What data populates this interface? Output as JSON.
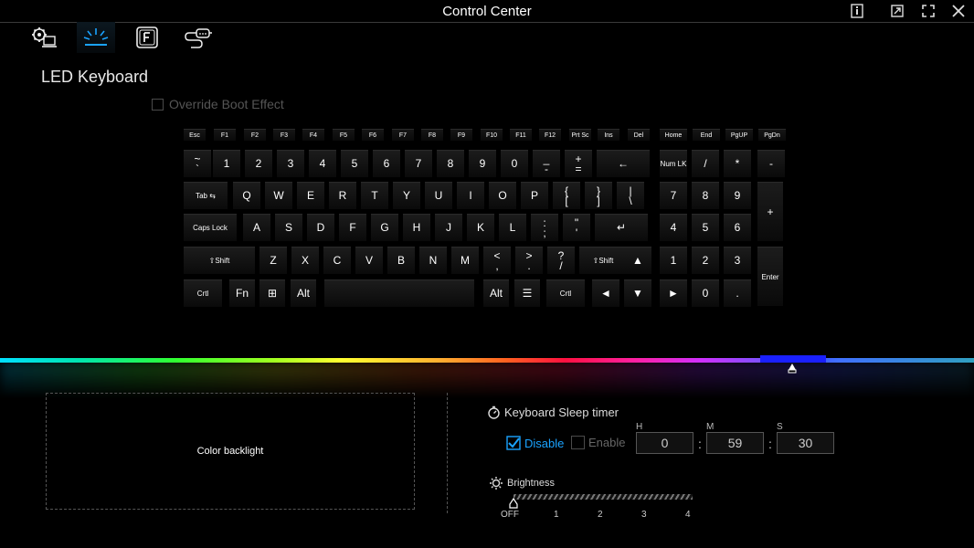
{
  "window": {
    "title": "Control Center"
  },
  "tabs": [
    {
      "icon": "system-settings-icon"
    },
    {
      "icon": "led-lighting-icon",
      "active": true
    },
    {
      "icon": "function-key-icon"
    },
    {
      "icon": "usb-device-icon"
    }
  ],
  "page": {
    "title": "LED Keyboard"
  },
  "override_boot": {
    "label": "Override Boot Effect",
    "checked": false
  },
  "keyboard": {
    "rows": [
      [
        {
          "label": "Esc"
        },
        {
          "label": "F1"
        },
        {
          "label": "F2"
        },
        {
          "label": "F3"
        },
        {
          "label": "F4"
        },
        {
          "label": "F5"
        },
        {
          "label": "F6"
        },
        {
          "label": "F7"
        },
        {
          "label": "F8"
        },
        {
          "label": "F9"
        },
        {
          "label": "F10"
        },
        {
          "label": "F11"
        },
        {
          "label": "F12"
        },
        {
          "label": "Prt Sc"
        },
        {
          "label": "Ins"
        },
        {
          "label": "Del"
        },
        {
          "label": "Home"
        },
        {
          "label": "End"
        },
        {
          "label": "PgUP"
        },
        {
          "label": "PgDn"
        }
      ],
      [
        {
          "label": "~\n`"
        },
        {
          "label": "1"
        },
        {
          "label": "2"
        },
        {
          "label": "3"
        },
        {
          "label": "4"
        },
        {
          "label": "5"
        },
        {
          "label": "6"
        },
        {
          "label": "7"
        },
        {
          "label": "8"
        },
        {
          "label": "9"
        },
        {
          "label": "0"
        },
        {
          "label": "_\n-"
        },
        {
          "label": "+\n="
        },
        {
          "label": "←"
        },
        {
          "label": "Num LK"
        },
        {
          "label": "/"
        },
        {
          "label": "*"
        },
        {
          "label": "-"
        }
      ],
      [
        {
          "label": "Tab ⇆"
        },
        {
          "label": "Q"
        },
        {
          "label": "W"
        },
        {
          "label": "E"
        },
        {
          "label": "R"
        },
        {
          "label": "T"
        },
        {
          "label": "Y"
        },
        {
          "label": "U"
        },
        {
          "label": "I"
        },
        {
          "label": "O"
        },
        {
          "label": "P"
        },
        {
          "label": "{\n["
        },
        {
          "label": "}\n]"
        },
        {
          "label": "|\n\\"
        },
        {
          "label": "7"
        },
        {
          "label": "8"
        },
        {
          "label": "9"
        },
        {
          "label": "+"
        }
      ],
      [
        {
          "label": "Caps Lock"
        },
        {
          "label": "A"
        },
        {
          "label": "S"
        },
        {
          "label": "D"
        },
        {
          "label": "F"
        },
        {
          "label": "G"
        },
        {
          "label": "H"
        },
        {
          "label": "J"
        },
        {
          "label": "K"
        },
        {
          "label": "L"
        },
        {
          "label": ":\n;"
        },
        {
          "label": "\"\n'"
        },
        {
          "label": "↵"
        },
        {
          "label": "4"
        },
        {
          "label": "5"
        },
        {
          "label": "6"
        }
      ],
      [
        {
          "label": "⇧Shift"
        },
        {
          "label": "Z"
        },
        {
          "label": "X"
        },
        {
          "label": "C"
        },
        {
          "label": "V"
        },
        {
          "label": "B"
        },
        {
          "label": "N"
        },
        {
          "label": "M"
        },
        {
          "label": "<\n,"
        },
        {
          "label": ">\n."
        },
        {
          "label": "?\n/"
        },
        {
          "label": "⇧Shift"
        },
        {
          "label": "▲"
        },
        {
          "label": "1"
        },
        {
          "label": "2"
        },
        {
          "label": "3"
        },
        {
          "label": "Enter"
        }
      ],
      [
        {
          "label": "Crtl"
        },
        {
          "label": "Fn"
        },
        {
          "label": "⊞"
        },
        {
          "label": "Alt"
        },
        {
          "label": ""
        },
        {
          "label": "Alt"
        },
        {
          "label": "☰"
        },
        {
          "label": "Crtl"
        },
        {
          "label": "◄"
        },
        {
          "label": "▼"
        },
        {
          "label": "►"
        },
        {
          "label": "0"
        },
        {
          "label": "."
        }
      ]
    ]
  },
  "color_bar": {
    "selected_color": "#1a20ff"
  },
  "backlight": {
    "label": "Color backlight"
  },
  "sleep_timer": {
    "title": "Keyboard Sleep timer",
    "disable_label": "Disable",
    "enable_label": "Enable",
    "selected": "Disable",
    "h_label": "H",
    "m_label": "M",
    "s_label": "S",
    "hours": "0",
    "minutes": "59",
    "seconds": "30",
    "sep": ":"
  },
  "brightness": {
    "title": "Brightness",
    "ticks": [
      "OFF",
      "1",
      "2",
      "3",
      "4"
    ],
    "value": "OFF"
  },
  "colors": {
    "accent": "#1aa3ff",
    "muted": "#555555"
  }
}
